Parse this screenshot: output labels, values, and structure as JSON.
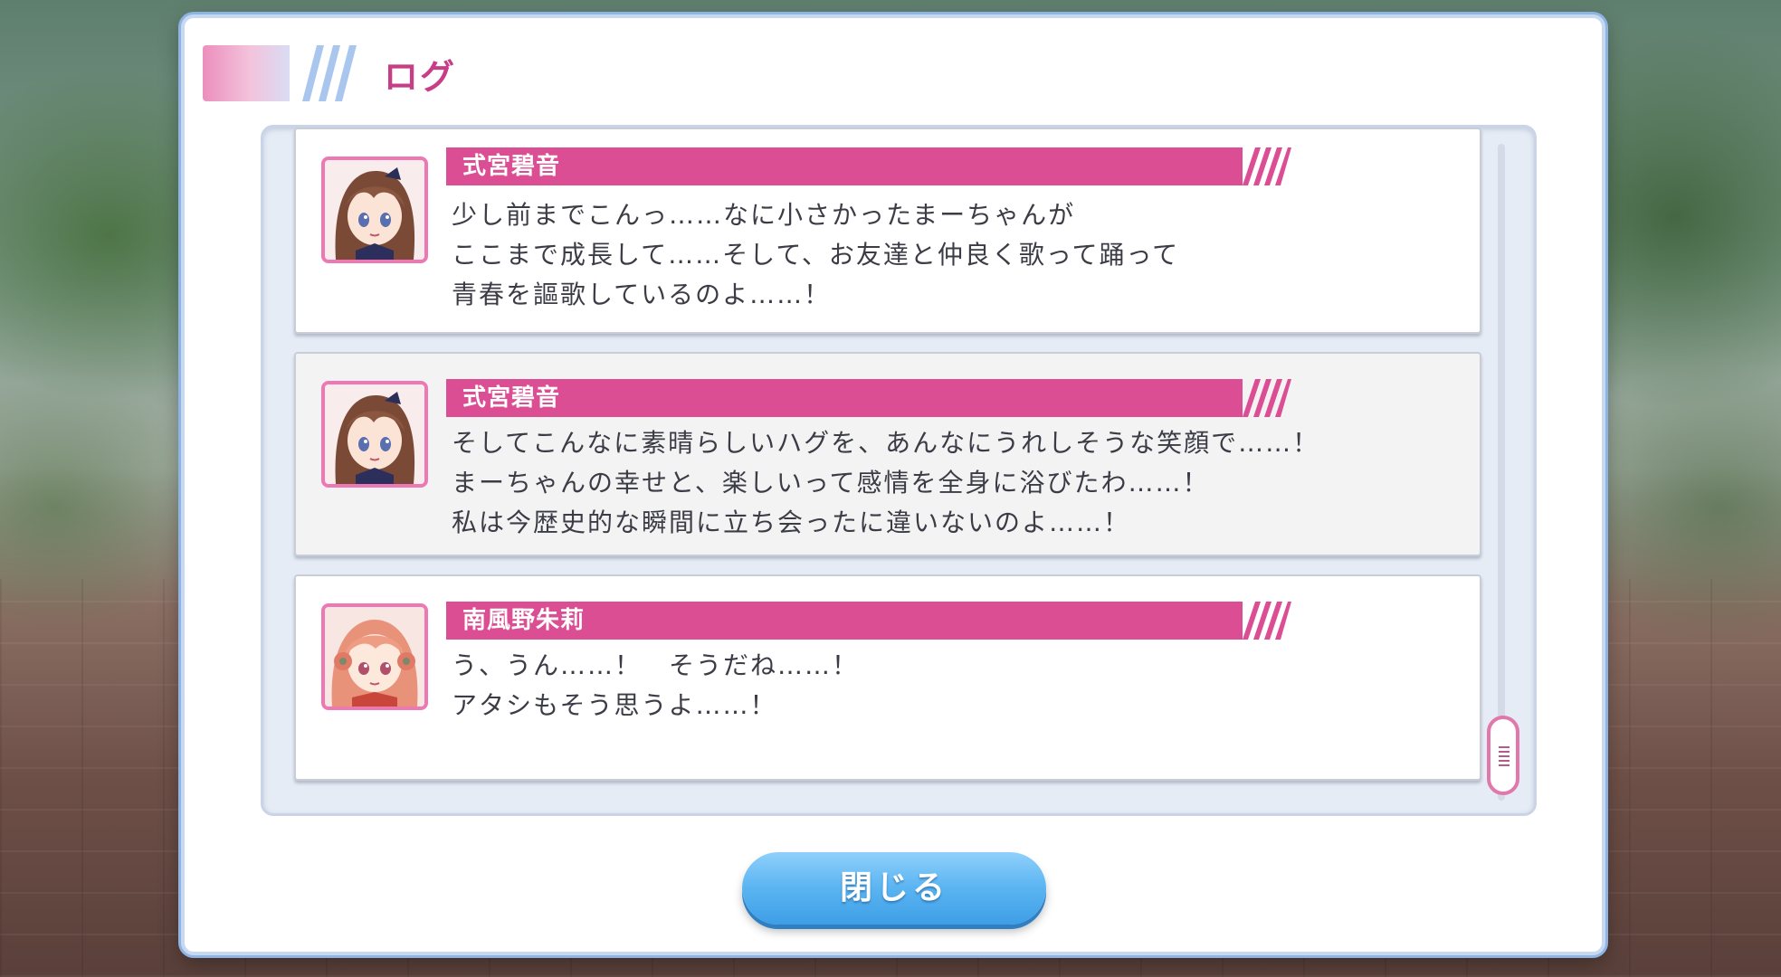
{
  "dialog": {
    "title": "ログ",
    "close_label": "閉じる"
  },
  "log": {
    "entries": [
      {
        "speaker": "式宮碧音",
        "avatar": "shikimiya-akane-portrait",
        "lines": [
          "少し前までこんっ……なに小さかったまーちゃんが",
          "ここまで成長して……そして、お友達と仲良く歌って踊って",
          "青春を謳歌しているのよ……！"
        ]
      },
      {
        "speaker": "式宮碧音",
        "avatar": "shikimiya-akane-portrait",
        "lines": [
          "そしてこんなに素晴らしいハグを、あんなにうれしそうな笑顔で……！",
          "まーちゃんの幸せと、楽しいって感情を全身に浴びたわ……！",
          "私は今歴史的な瞬間に立ち会ったに違いないのよ……！"
        ]
      },
      {
        "speaker": "南風野朱莉",
        "avatar": "haeno-akari-portrait",
        "lines": [
          "う、うん……！　そうだね……！",
          "アタシもそう思うよ……！"
        ]
      }
    ]
  },
  "colors": {
    "accent": "#dc4e93",
    "title": "#c83e86",
    "button": "#5ab4f1"
  }
}
